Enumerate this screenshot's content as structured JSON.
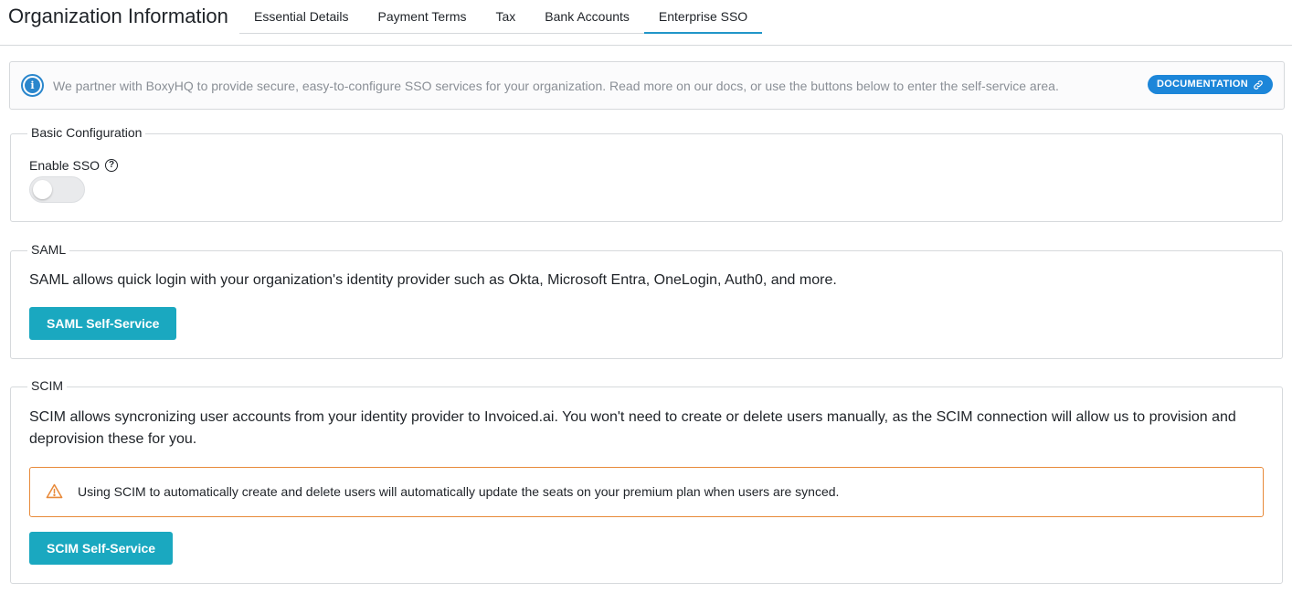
{
  "header": {
    "title": "Organization Information",
    "tabs": [
      {
        "label": "Essential Details",
        "active": false
      },
      {
        "label": "Payment Terms",
        "active": false
      },
      {
        "label": "Tax",
        "active": false
      },
      {
        "label": "Bank Accounts",
        "active": false
      },
      {
        "label": "Enterprise SSO",
        "active": true
      }
    ]
  },
  "info_banner": {
    "icon": "info-icon",
    "text": "We partner with BoxyHQ to provide secure, easy-to-configure SSO services for your organization. Read more on our docs, or use the buttons below to enter the self-service area.",
    "doc_button": "DOCUMENTATION",
    "doc_button_icon": "link-icon"
  },
  "basic": {
    "legend": "Basic Configuration",
    "enable_label": "Enable SSO",
    "help_icon": "help-icon",
    "enabled": false
  },
  "saml": {
    "legend": "SAML",
    "description": "SAML allows quick login with your organization's identity provider such as Okta, Microsoft Entra, OneLogin, Auth0, and more.",
    "button": "SAML Self-Service"
  },
  "scim": {
    "legend": "SCIM",
    "description": "SCIM allows syncronizing user accounts from your identity provider to Invoiced.ai. You won't need to create or delete users manually, as the SCIM connection will allow us to provision and deprovision these for you.",
    "warning": "Using SCIM to automatically create and delete users will automatically update the seats on your premium plan when users are synced.",
    "warning_icon": "warning-icon",
    "button": "SCIM Self-Service"
  },
  "colors": {
    "accent": "#1aa8c0",
    "tab_underline": "#2196c9",
    "info": "#2a86cc",
    "doc_button": "#1c86d9",
    "warning_border": "#e88a3a"
  }
}
